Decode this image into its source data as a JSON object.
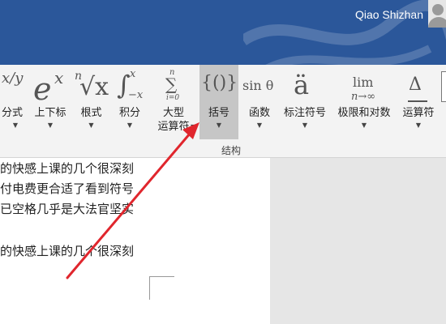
{
  "window": {
    "user_name": "Qiao Shizhan"
  },
  "ribbon": {
    "group_label": "结构",
    "buttons": [
      {
        "label": "分式"
      },
      {
        "label": "上下标"
      },
      {
        "label": "根式"
      },
      {
        "label": "积分"
      },
      {
        "label_line1": "大型",
        "label_line2": "运算符"
      },
      {
        "label": "括号"
      },
      {
        "label": "函数"
      },
      {
        "label": "标注符号"
      },
      {
        "label": "极限和对数"
      },
      {
        "label": "运算符"
      }
    ],
    "icons": {
      "fraction": "x/y",
      "script": "e",
      "script_sup": "x",
      "radical_index": "n",
      "radical_body": "√x",
      "integral": "∫",
      "integral_upper": "x",
      "integral_lower": "−x",
      "large_op": "∑",
      "large_op_upper": "n",
      "large_op_lower": "i=0",
      "bracket": "{()}",
      "function": "sin θ",
      "accent": "ä",
      "limit_top": "lim",
      "limit_bottom": "n→∞",
      "operator": "Δ"
    },
    "selected": "括号"
  },
  "document": {
    "lines": [
      "的快感上课的几个很深刻",
      "付电费更合适了看到符号",
      "已空格几乎是大法官坚实",
      "",
      "的快感上课的几个很深刻"
    ]
  },
  "annotation": {
    "color": "#e0262d"
  }
}
